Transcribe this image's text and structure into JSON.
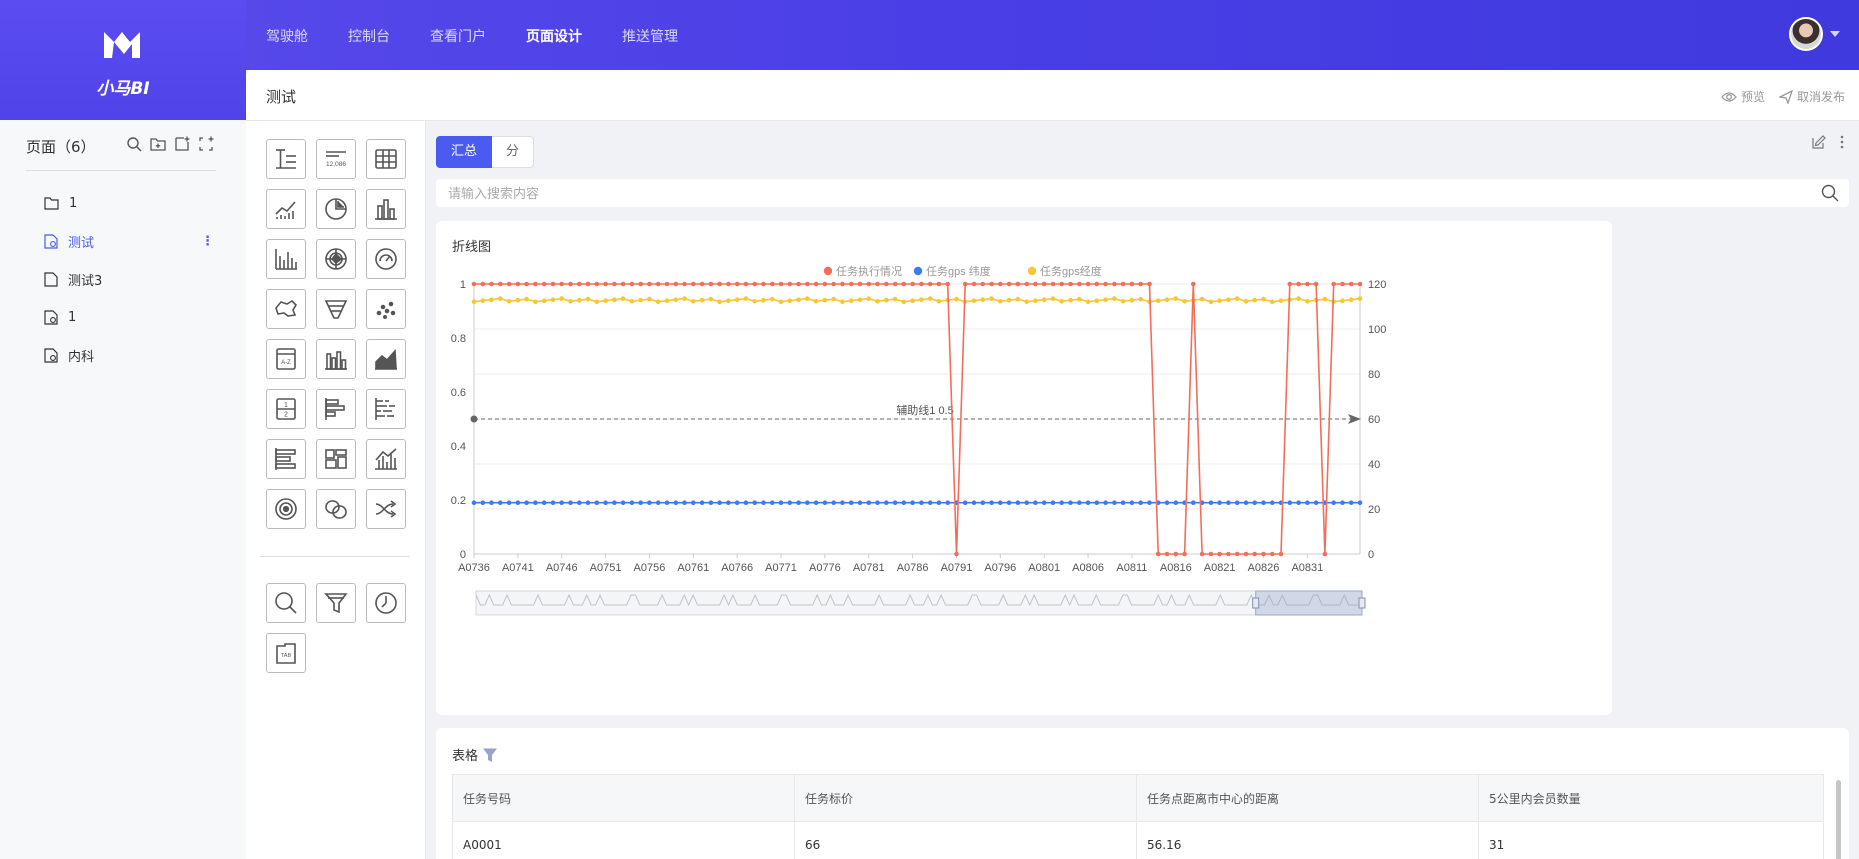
{
  "app": {
    "name": "小马BI"
  },
  "nav": {
    "items": [
      "驾驶舱",
      "控制台",
      "查看门户",
      "页面设计",
      "推送管理"
    ],
    "active": 3
  },
  "title": {
    "text": "测试",
    "preview": "预览",
    "unpublish": "取消发布"
  },
  "sidebar": {
    "header": "页面（6）",
    "items": [
      {
        "label": "1",
        "icon": "folder-icon"
      },
      {
        "label": "测试",
        "icon": "page-edit-icon",
        "active": true
      },
      {
        "label": "测试3",
        "icon": "page-icon"
      },
      {
        "label": "1",
        "icon": "page-edit-icon"
      },
      {
        "label": "内科",
        "icon": "page-edit-icon"
      }
    ]
  },
  "palette": {
    "number_icon_text": "12,086",
    "sort_icon_text": "A-Z",
    "fraction_top": "1",
    "fraction_bottom": "2",
    "tab_icon_text": "TAB"
  },
  "canvas": {
    "tabs": [
      "汇总",
      "分"
    ],
    "search_placeholder": "请输入搜索内容"
  },
  "chart_data": {
    "type": "line",
    "title": "折线图",
    "x_ticks": [
      "A0736",
      "A0741",
      "A0746",
      "A0751",
      "A0756",
      "A0761",
      "A0766",
      "A0771",
      "A0776",
      "A0781",
      "A0786",
      "A0791",
      "A0796",
      "A0801",
      "A0806",
      "A0811",
      "A0816",
      "A0821",
      "A0826",
      "A0831"
    ],
    "x_start": 736,
    "x_end": 837,
    "y_left": {
      "min": 0,
      "max": 1,
      "ticks": [
        0,
        0.2,
        0.4,
        0.6,
        0.8,
        1
      ]
    },
    "y_right": {
      "min": 0,
      "max": 120,
      "ticks": [
        0,
        20,
        40,
        60,
        80,
        100,
        120
      ]
    },
    "series": [
      {
        "name": "任务执行情况",
        "color": "#f26e5a",
        "axis": "left",
        "default": 1,
        "zero_indices": [
          55,
          78,
          79,
          80,
          81,
          83,
          84,
          85,
          86,
          87,
          88,
          89,
          90,
          91,
          92,
          97
        ]
      },
      {
        "name": "任务gps 纬度",
        "color": "#3a7cf0",
        "axis": "left",
        "default": 0.19
      },
      {
        "name": "任务gps经度",
        "color": "#f7c634",
        "axis": "left",
        "default": 0.94
      }
    ],
    "markline": {
      "label": "辅助线1 0.5",
      "value": 0.5
    },
    "legend_position": "top-center",
    "grid": true
  },
  "table": {
    "title": "表格",
    "columns": [
      "任务号码",
      "任务标价",
      "任务点距离市中心的距离",
      "5公里内会员数量"
    ],
    "rows": [
      [
        "A0001",
        "66",
        "56.16",
        "31"
      ]
    ]
  }
}
